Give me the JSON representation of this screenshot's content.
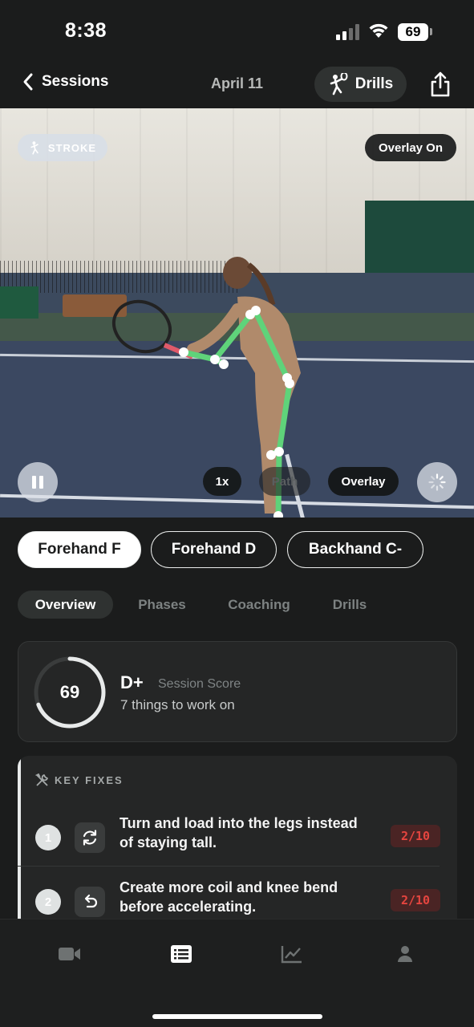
{
  "status_bar": {
    "time": "8:38",
    "battery": "69"
  },
  "nav": {
    "back_label": "Sessions",
    "date": "April 11",
    "drills_label": "Drills"
  },
  "video": {
    "stroke_chip": "STROKE",
    "overlay_on": "Overlay On",
    "speed": "1x",
    "path": "Path",
    "overlay": "Overlay"
  },
  "strokes": [
    {
      "label": "Forehand F",
      "active": true
    },
    {
      "label": "Forehand D",
      "active": false
    },
    {
      "label": "Backhand C-",
      "active": false
    }
  ],
  "tabs": [
    {
      "label": "Overview",
      "active": true
    },
    {
      "label": "Phases",
      "active": false
    },
    {
      "label": "Coaching",
      "active": false
    },
    {
      "label": "Drills",
      "active": false
    }
  ],
  "score": {
    "value": "69",
    "progress": 0.69,
    "grade": "D+",
    "label": "Session Score",
    "todo": "7 things to work on"
  },
  "key_fixes": {
    "heading": "KEY FIXES",
    "items": [
      {
        "num": "1",
        "icon": "rotate-icon",
        "text": "Turn and load into the legs instead of staying tall.",
        "score": "2/10"
      },
      {
        "num": "2",
        "icon": "undo-icon",
        "text": "Create more coil and knee bend before accelerating.",
        "score": "2/10"
      }
    ]
  },
  "tab_bar": [
    "video-icon",
    "list-icon",
    "chart-icon",
    "profile-icon"
  ],
  "colors": {
    "accent_green": "#5fd37a",
    "danger": "#e5453f",
    "background": "#1b1c1c"
  }
}
